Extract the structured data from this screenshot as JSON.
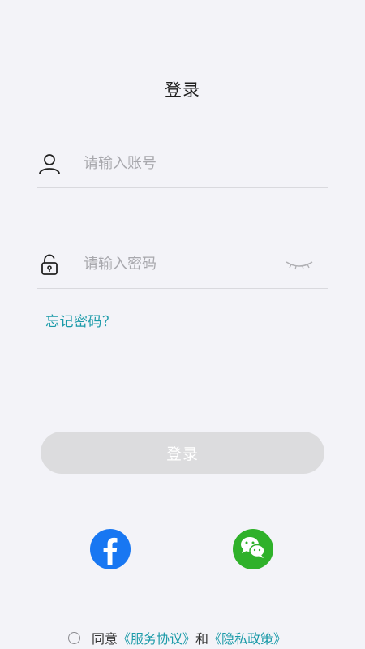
{
  "page": {
    "title": "登录"
  },
  "account": {
    "placeholder": "请输入账号",
    "icon": "user-icon"
  },
  "password": {
    "placeholder": "请输入密码",
    "icon": "unlock-icon",
    "toggle_icon": "eye-closed-icon"
  },
  "forgot_password": "忘记密码？",
  "login_button": "登录",
  "social": {
    "facebook_icon": "facebook-icon",
    "wechat_icon": "wechat-icon"
  },
  "agreement": {
    "prefix": "同意",
    "terms": "《服务协议》",
    "and": "和",
    "privacy": "《隐私政策》"
  },
  "colors": {
    "background": "#f3f3f8",
    "accent": "#1a9aa8",
    "button_disabled": "#dcdcde",
    "facebook": "#1877f2",
    "wechat": "#2fb12a"
  }
}
